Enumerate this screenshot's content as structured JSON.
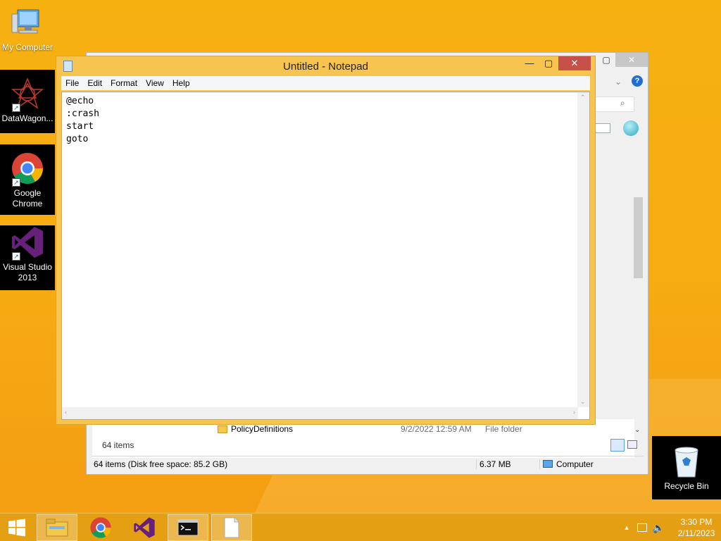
{
  "desktop": {
    "icons": [
      {
        "label": "My Computer"
      },
      {
        "label": "DataWagon..."
      },
      {
        "label": "Google Chrome"
      },
      {
        "label": "Visual Studio 2013"
      }
    ],
    "recycle_bin": "Recycle Bin"
  },
  "explorer": {
    "file_row": {
      "name": "PolicyDefinitions",
      "date": "9/2/2022 12:59 AM",
      "type": "File folder"
    },
    "item_count": "64 items",
    "status": {
      "left": "64 items (Disk free space: 85.2 GB)",
      "size": "6.37 MB",
      "location": "Computer"
    }
  },
  "notepad": {
    "title": "Untitled - Notepad",
    "menu": [
      "File",
      "Edit",
      "Format",
      "View",
      "Help"
    ],
    "content": "@echo\n:crash\nstart\ngoto"
  },
  "taskbar": {
    "clock_time": "3:30 PM",
    "clock_date": "2/11/2023"
  },
  "colors": {
    "desktop": "#f6b111",
    "notepad_frame": "#f6c44f",
    "close_button": "#c7504a"
  }
}
